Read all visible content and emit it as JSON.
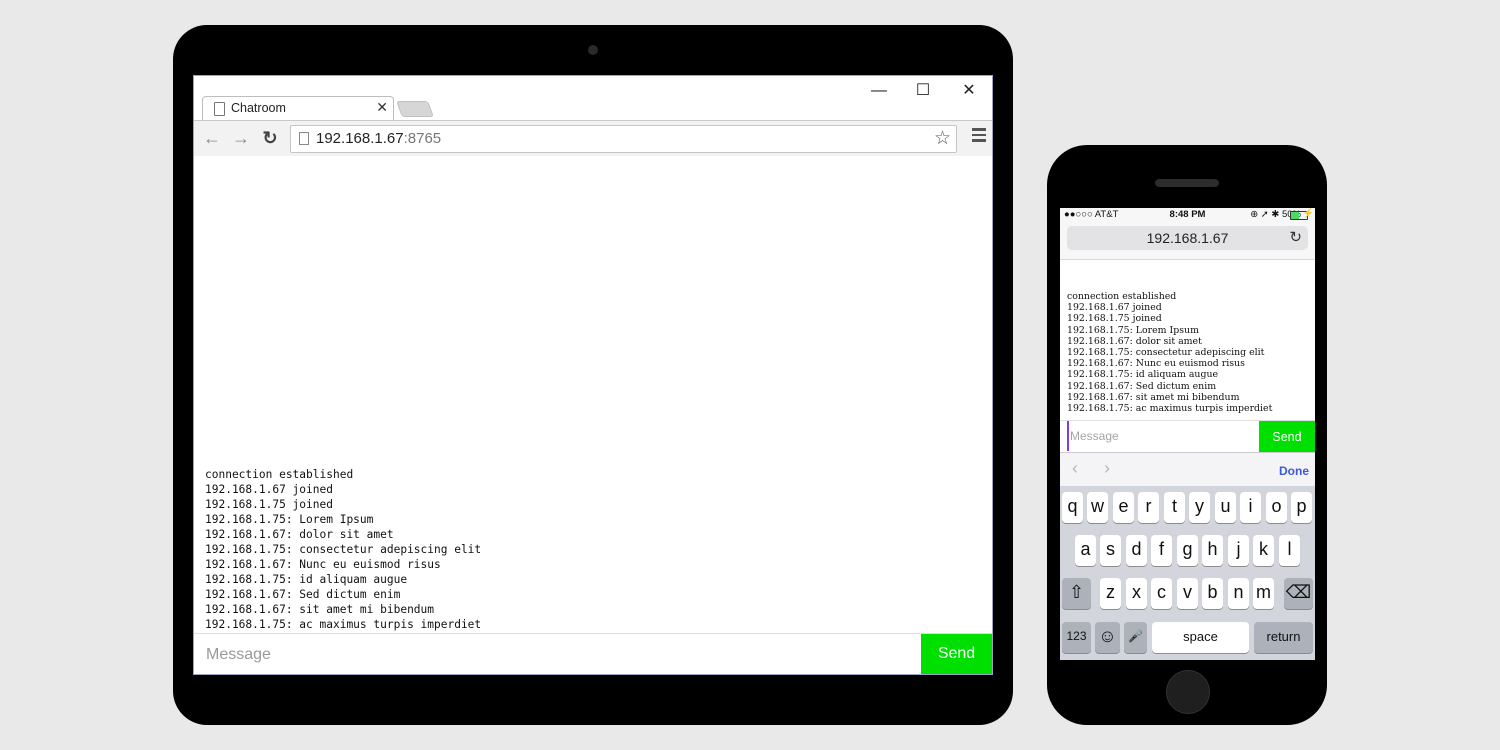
{
  "tablet": {
    "browser": {
      "tab_title": "Chatroom",
      "tab_close": "✕",
      "window_controls": {
        "minimize": "—",
        "maximize": "☐",
        "close": "✕"
      },
      "nav": {
        "back": "←",
        "forward": "→",
        "reload": "↻"
      },
      "address": {
        "host": "192.168.1.67",
        "port": ":8765"
      },
      "star": "☆"
    },
    "chat": {
      "messages": [
        "connection established",
        "192.168.1.67 joined",
        "192.168.1.75 joined",
        "192.168.1.75: Lorem Ipsum",
        "192.168.1.67: dolor sit amet",
        "192.168.1.75: consectetur adepiscing elit",
        "192.168.1.67: Nunc eu euismod risus",
        "192.168.1.75: id aliquam augue",
        "192.168.1.67: Sed dictum enim",
        "192.168.1.67: sit amet mi bibendum",
        "192.168.1.75: ac maximus turpis imperdiet"
      ],
      "input_placeholder": "Message",
      "send_label": "Send",
      "send_color": "#00e000"
    }
  },
  "phone": {
    "status": {
      "carrier": "●●○○○ AT&T",
      "time": "8:48 PM",
      "right": "⊕ ➚ ✱ 50%",
      "bolt": "⚡"
    },
    "url": "192.168.1.67",
    "reload": "↻",
    "chat": {
      "messages": [
        "connection established",
        "192.168.1.67 joined",
        "192.168.1.75 joined",
        "192.168.1.75: Lorem Ipsum",
        "192.168.1.67: dolor sit amet",
        "192.168.1.75: consectetur adepiscing elit",
        "192.168.1.67: Nunc eu euismod risus",
        "192.168.1.75: id aliquam augue",
        "192.168.1.67: Sed dictum enim",
        "192.168.1.67: sit amet mi bibendum",
        "192.168.1.75: ac maximus turpis imperdiet"
      ],
      "input_placeholder": "Message",
      "send_label": "Send"
    },
    "accessory": {
      "prev": "‹",
      "next": "›",
      "done": "Done"
    },
    "keyboard": {
      "row1": [
        "q",
        "w",
        "e",
        "r",
        "t",
        "y",
        "u",
        "i",
        "o",
        "p"
      ],
      "row2": [
        "a",
        "s",
        "d",
        "f",
        "g",
        "h",
        "j",
        "k",
        "l"
      ],
      "row3": [
        "z",
        "x",
        "c",
        "v",
        "b",
        "n",
        "m"
      ],
      "shift": "⇧",
      "backspace": "⌫",
      "numbers": "123",
      "emoji": "☺",
      "mic": "🎤",
      "space": "space",
      "return": "return"
    }
  }
}
